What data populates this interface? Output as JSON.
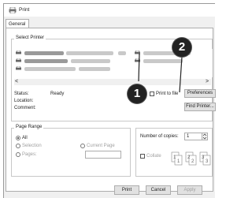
{
  "window": {
    "title": "Print"
  },
  "tabs": [
    {
      "label": "General"
    }
  ],
  "select_printer": {
    "group_label": "Select Printer",
    "status_label": "Status:",
    "status_value": "Ready",
    "location_label": "Location:",
    "comment_label": "Comment:",
    "print_to_file_label": "Print to file",
    "preferences_label": "Preferences",
    "find_printer_label": "Find Printer...",
    "scroll_left": "<",
    "scroll_right": ">"
  },
  "page_range": {
    "group_label": "Page Range",
    "all_label": "All",
    "selection_label": "Selection",
    "current_page_label": "Current Page",
    "pages_label": "Pages:",
    "selected": "All"
  },
  "copies": {
    "number_label": "Number of copies:",
    "number_value": "1",
    "collate_label": "Collate",
    "collate_pages": [
      "1",
      "1",
      "2",
      "2",
      "3",
      "3"
    ]
  },
  "buttons": {
    "print": "Print",
    "cancel": "Cancel",
    "apply": "Apply"
  },
  "callouts": [
    {
      "label": "1"
    },
    {
      "label": "2"
    }
  ],
  "colors": {
    "callout_bg": "#222222",
    "button_bg": "#e1e1e1",
    "border": "#adadad"
  }
}
